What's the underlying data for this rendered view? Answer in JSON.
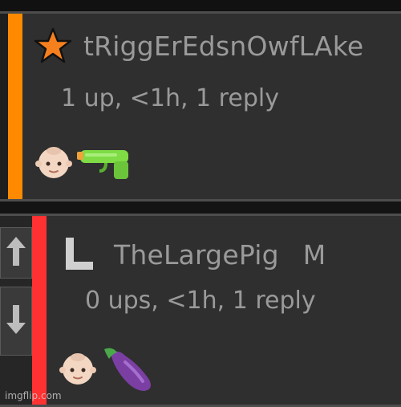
{
  "comments": [
    {
      "username": "tRiggErEdsnOwfLAke",
      "meta": "1 up, <1h, 1 reply",
      "badge_icon": "star-icon",
      "badge_color": "#f7801e",
      "stripe_color": "#ff8a00",
      "body_icons": [
        "baby-face-icon",
        "water-gun-icon"
      ]
    },
    {
      "username": "TheLargePig",
      "gender_flag": "M",
      "meta": "0 ups, <1h, 1 reply",
      "badge_icon": "reply-elbow-icon",
      "badge_color": "#d0d0d0",
      "stripe_color": "#ff3131",
      "body_icons": [
        "baby-face-icon",
        "eggplant-icon"
      ]
    }
  ],
  "watermark": "imgflip.com"
}
